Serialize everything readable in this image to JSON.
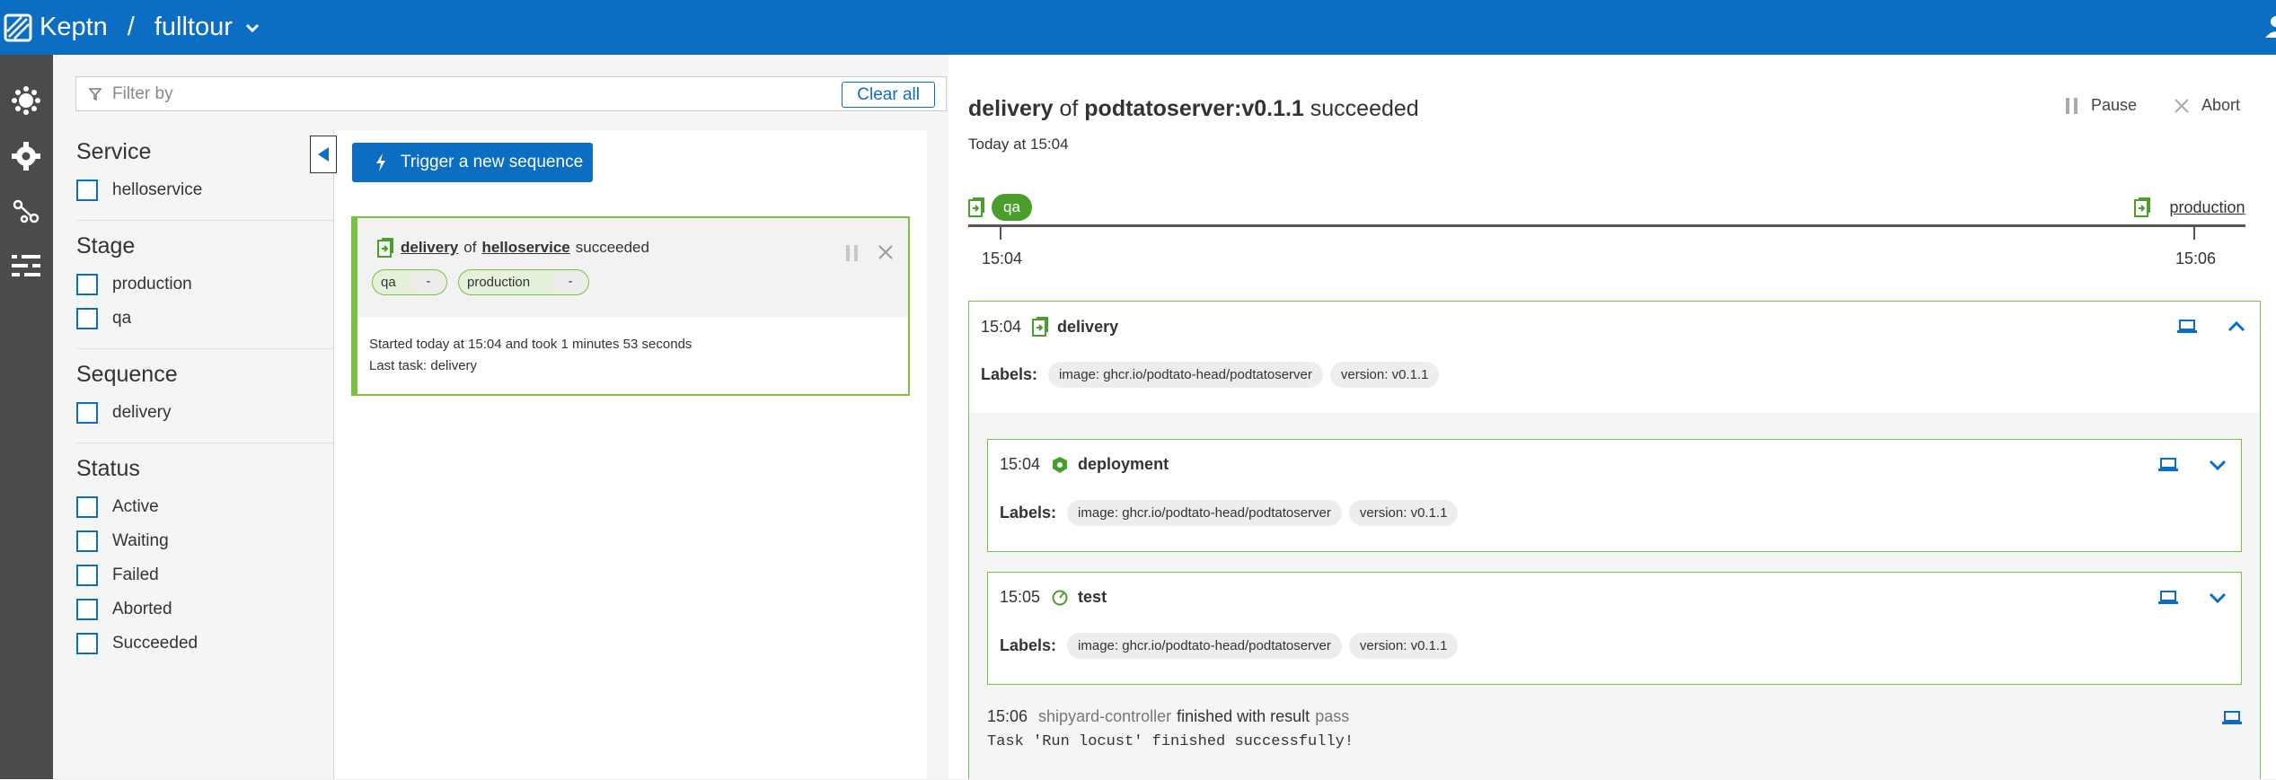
{
  "header": {
    "app_name": "Keptn",
    "separator": "/",
    "project": "fulltour"
  },
  "filters": {
    "placeholder": "Filter by",
    "clear_label": "Clear all",
    "groups": [
      {
        "title": "Service",
        "items": [
          "helloservice"
        ]
      },
      {
        "title": "Stage",
        "items": [
          "production",
          "qa"
        ]
      },
      {
        "title": "Sequence",
        "items": [
          "delivery"
        ]
      },
      {
        "title": "Status",
        "items": [
          "Active",
          "Waiting",
          "Failed",
          "Aborted",
          "Succeeded"
        ]
      }
    ]
  },
  "sequences": {
    "trigger_label": "Trigger a new sequence",
    "card": {
      "name": "delivery",
      "of": "of",
      "service": "helloservice",
      "status": "succeeded",
      "stages": [
        {
          "name": "qa",
          "count": "-"
        },
        {
          "name": "production",
          "count": "-"
        }
      ],
      "started": "Started today at 15:04 and took 1 minutes 53 seconds",
      "last_task": "Last task: delivery"
    }
  },
  "detail": {
    "sequence": "delivery",
    "of": "of",
    "image": "podtatoserver:v0.1.1",
    "status": "succeeded",
    "time": "Today at 15:04",
    "pause_label": "Pause",
    "abort_label": "Abort",
    "timeline": {
      "stages": [
        "qa",
        "production"
      ],
      "times": [
        "15:04",
        "15:06"
      ]
    },
    "task": {
      "time": "15:04",
      "name": "delivery",
      "labels_title": "Labels:",
      "labels": [
        "image: ghcr.io/podtato-head/podtatoserver",
        "version: v0.1.1"
      ],
      "subtasks": [
        {
          "time": "15:04",
          "name": "deployment",
          "labels": [
            "image: ghcr.io/podtato-head/podtatoserver",
            "version: v0.1.1"
          ]
        },
        {
          "time": "15:05",
          "name": "test",
          "labels": [
            "image: ghcr.io/podtato-head/podtatoserver",
            "version: v0.1.1"
          ]
        }
      ],
      "log": {
        "time": "15:06",
        "source": "shipyard-controller",
        "text": "finished with result",
        "result": "pass",
        "message": "Task 'Run locust' finished successfully!"
      }
    }
  },
  "colors": {
    "brand": "#0b6ec2",
    "success": "#7bc043",
    "nav": "#4b4b4b"
  }
}
